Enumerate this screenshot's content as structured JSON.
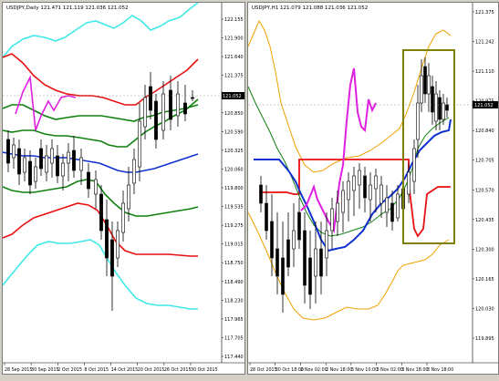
{
  "left_chart": {
    "title": "USDJPY,Daily  121.471 121.119 121.036 121.052",
    "price_label": "121.052",
    "y_ticks": [
      "122.155",
      "121.900",
      "121.640",
      "121.375",
      "121.110",
      "120.850",
      "120.590",
      "120.325",
      "120.060",
      "119.800",
      "119.535",
      "119.275",
      "119.015",
      "118.750",
      "118.490",
      "118.230",
      "117.965",
      "117.705",
      "117.440"
    ],
    "x_ticks": [
      "28 Sep 2015",
      "30 Sep 2015",
      "2 Oct 2015",
      "8 Oct 2015",
      "14 Oct 2015",
      "20 Oct 2015",
      "26 Oct 2015",
      "30 Oct 2015"
    ],
    "colors": {
      "cyan": "#40e8e8",
      "red": "#e81010",
      "green": "#108010",
      "blue": "#1030d0",
      "magenta": "#e020e0",
      "candle": "#000000"
    }
  },
  "right_chart": {
    "title": "USDJPY,H1  121.079 121.088 121.036 121.052",
    "price_label": "121.052",
    "y_ticks": [
      "121.375",
      "121.242",
      "121.110",
      "120.975",
      "120.840",
      "120.705",
      "120.570",
      "120.435",
      "120.300",
      "120.165",
      "120.030",
      "119.895"
    ],
    "x_ticks": [
      "28 Oct 2015",
      "30 Oct 18:00",
      "2 Nov 02:00",
      "2 Nov 18:00",
      "3 Nov 10:00",
      "3 Nov 02:00",
      "3 Nov 18:00",
      "3 Nov 18:00"
    ],
    "colors": {
      "orange": "#f0a000",
      "red": "#e81010",
      "green": "#108010",
      "blue": "#1030d0",
      "magenta": "#e020e0",
      "box": "#808000",
      "candle": "#000000"
    }
  }
}
